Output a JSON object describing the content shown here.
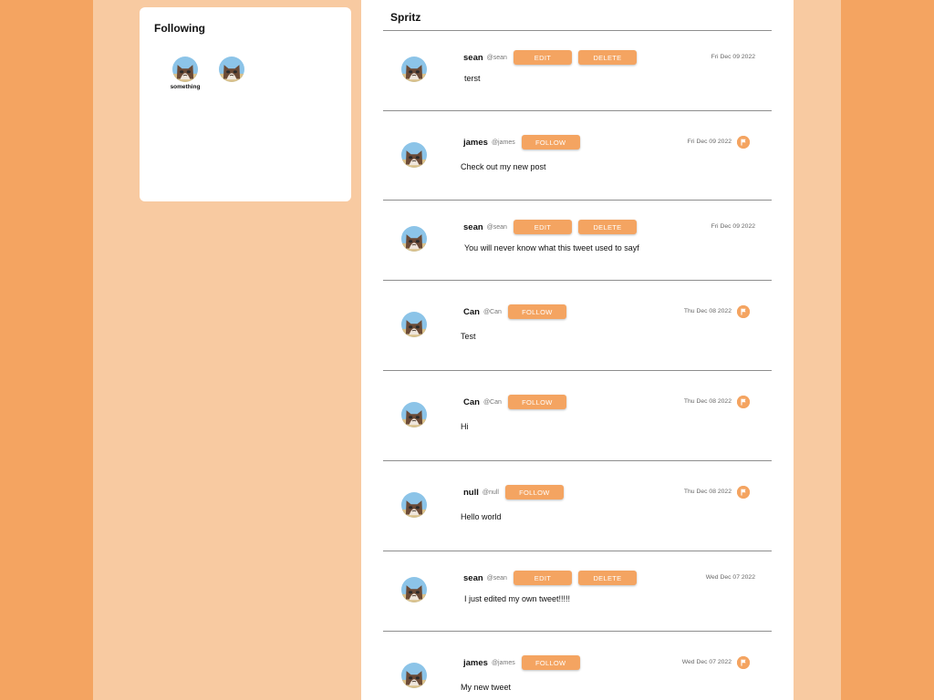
{
  "following": {
    "title": "Following",
    "users": [
      {
        "name": "something"
      },
      {
        "name": ""
      }
    ]
  },
  "feed": {
    "title": "Spritz",
    "labels": {
      "edit": "EDIT",
      "delete": "DELETE",
      "follow": "FOLLOW"
    },
    "tweets": [
      {
        "name": "sean",
        "handle": "@sean",
        "own": true,
        "date": "Fri Dec 09 2022",
        "text": "terst"
      },
      {
        "name": "james",
        "handle": "@james",
        "own": false,
        "date": "Fri Dec 09 2022",
        "text": "Check out my new post"
      },
      {
        "name": "sean",
        "handle": "@sean",
        "own": true,
        "date": "Fri Dec 09 2022",
        "text": "You will never know what this tweet used to sayf"
      },
      {
        "name": "Can",
        "handle": "@Can",
        "own": false,
        "date": "Thu Dec 08 2022",
        "text": "Test"
      },
      {
        "name": "Can",
        "handle": "@Can",
        "own": false,
        "date": "Thu Dec 08 2022",
        "text": "Hi"
      },
      {
        "name": "null",
        "handle": "@null",
        "own": false,
        "date": "Thu Dec 08 2022",
        "text": "Hello world"
      },
      {
        "name": "sean",
        "handle": "@sean",
        "own": true,
        "date": "Wed Dec 07 2022",
        "text": "I just edited my own tweet!!!!!"
      },
      {
        "name": "james",
        "handle": "@james",
        "own": false,
        "date": "Wed Dec 07 2022",
        "text": "My new tweet"
      }
    ]
  },
  "colors": {
    "accent": "#f4a461",
    "page_band": "#f8caa1",
    "outer": "#f4a461"
  },
  "icons": {
    "avatar": "grumpy-cat-avatar-icon",
    "report": "flag-icon"
  }
}
